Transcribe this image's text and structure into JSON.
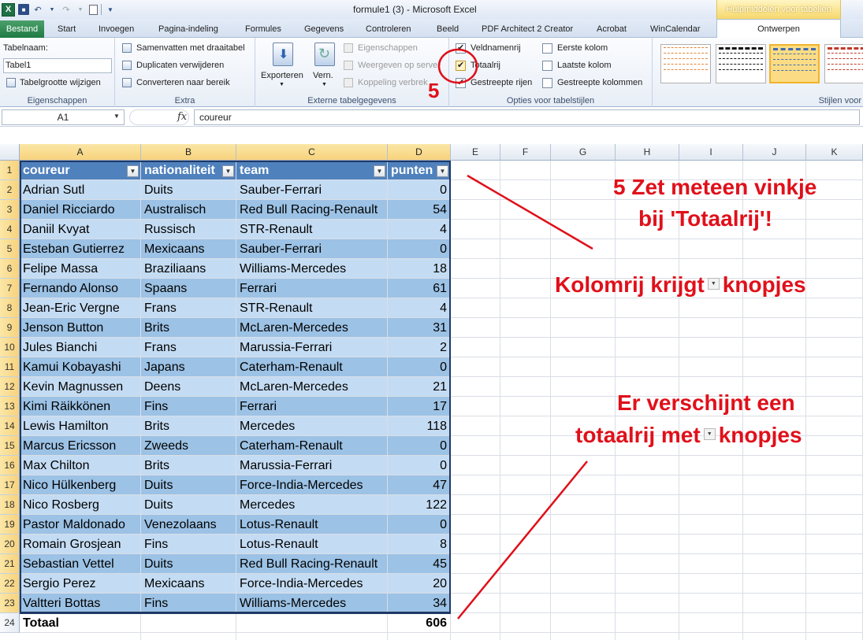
{
  "app": {
    "window_title": "formule1 (3)  -  Microsoft Excel",
    "context_tab_title": "Hulpmiddelen voor tabellen"
  },
  "tabs": [
    {
      "label": "Bestand"
    },
    {
      "label": "Start"
    },
    {
      "label": "Invoegen"
    },
    {
      "label": "Pagina-indeling"
    },
    {
      "label": "Formules"
    },
    {
      "label": "Gegevens"
    },
    {
      "label": "Controleren"
    },
    {
      "label": "Beeld"
    },
    {
      "label": "PDF Architect 2 Creator"
    },
    {
      "label": "Acrobat"
    },
    {
      "label": "WinCalendar"
    },
    {
      "label": "Ontwerpen"
    }
  ],
  "ribbon": {
    "eigenschappen": {
      "table_name_label": "Tabelnaam:",
      "table_name_value": "Tabel1",
      "resize_label": "Tabelgrootte wijzigen",
      "group_label": "Eigenschappen"
    },
    "extra": {
      "pivot_label": "Samenvatten met draaitabel",
      "remove_dup_label": "Duplicaten verwijderen",
      "convert_label": "Converteren naar bereik",
      "group_label": "Extra"
    },
    "extern": {
      "export_label": "Exporteren",
      "refresh_label": "Vern.",
      "properties_label": "Eigenschappen",
      "browser_label": "Weergeven op serve",
      "unlink_label": "Koppeling verbrek",
      "group_label": "Externe tabelgegevens"
    },
    "options": {
      "header_row": {
        "label": "Veldnamenrij",
        "checked": true
      },
      "total_row": {
        "label": "Totaalrij",
        "checked": true
      },
      "banded_rows": {
        "label": "Gestreepte rijen",
        "checked": true
      },
      "first_column": {
        "label": "Eerste kolom",
        "checked": false
      },
      "last_column": {
        "label": "Laatste kolom",
        "checked": false
      },
      "banded_columns": {
        "label": "Gestreepte kolommen",
        "checked": false
      },
      "group_label": "Opties voor tabelstijlen"
    },
    "styles": {
      "group_label": "Stijlen voor"
    }
  },
  "formula_bar": {
    "name_box": "A1",
    "fx_label": "fx",
    "formula": "coureur"
  },
  "grid": {
    "columns": [
      "A",
      "B",
      "C",
      "D",
      "E",
      "F",
      "G",
      "H",
      "I",
      "J",
      "K"
    ],
    "rows": [
      "1",
      "2",
      "3",
      "4",
      "5",
      "6",
      "7",
      "8",
      "9",
      "10",
      "11",
      "12",
      "13",
      "14",
      "15",
      "16",
      "17",
      "18",
      "19",
      "20",
      "21",
      "22",
      "23",
      "24"
    ],
    "table_headers": [
      "coureur",
      "nationaliteit",
      "team",
      "punten"
    ],
    "table_rows": [
      [
        "Adrian Sutl",
        "Duits",
        "Sauber-Ferrari",
        "0"
      ],
      [
        "Daniel Ricciardo",
        "Australisch",
        "Red Bull Racing-Renault",
        "54"
      ],
      [
        "Daniil Kvyat",
        "Russisch",
        "STR-Renault",
        "4"
      ],
      [
        "Esteban Gutierrez",
        "Mexicaans",
        "Sauber-Ferrari",
        "0"
      ],
      [
        "Felipe Massa",
        "Braziliaans",
        "Williams-Mercedes",
        "18"
      ],
      [
        "Fernando Alonso",
        "Spaans",
        "Ferrari",
        "61"
      ],
      [
        "Jean-Eric Vergne",
        "Frans",
        "STR-Renault",
        "4"
      ],
      [
        "Jenson Button",
        "Brits",
        "McLaren-Mercedes",
        "31"
      ],
      [
        "Jules Bianchi",
        "Frans",
        "Marussia-Ferrari",
        "2"
      ],
      [
        "Kamui Kobayashi",
        "Japans",
        "Caterham-Renault",
        "0"
      ],
      [
        "Kevin Magnussen",
        "Deens",
        "McLaren-Mercedes",
        "21"
      ],
      [
        "Kimi Räikkönen",
        "Fins",
        "Ferrari",
        "17"
      ],
      [
        "Lewis Hamilton",
        "Brits",
        "Mercedes",
        "118"
      ],
      [
        "Marcus Ericsson",
        "Zweeds",
        "Caterham-Renault",
        "0"
      ],
      [
        "Max Chilton",
        "Brits",
        "Marussia-Ferrari",
        "0"
      ],
      [
        "Nico Hülkenberg",
        "Duits",
        "Force-India-Mercedes",
        "47"
      ],
      [
        "Nico Rosberg",
        "Duits",
        "Mercedes",
        "122"
      ],
      [
        "Pastor Maldonado",
        "Venezolaans",
        "Lotus-Renault",
        "0"
      ],
      [
        "Romain Grosjean",
        "Fins",
        "Lotus-Renault",
        "8"
      ],
      [
        "Sebastian Vettel",
        "Duits",
        "Red Bull Racing-Renault",
        "45"
      ],
      [
        "Sergio Perez",
        "Mexicaans",
        "Force-India-Mercedes",
        "20"
      ],
      [
        "Valtteri Bottas",
        "Fins",
        "Williams-Mercedes",
        "34"
      ]
    ],
    "total_row": {
      "label": "Totaal",
      "value": "606"
    }
  },
  "annotations": {
    "step_number": "5",
    "line1": "5 Zet meteen vinkje",
    "line2": "bij 'Totaalrij'!",
    "line3a": "Kolomrij krijgt",
    "line3b": "knopjes",
    "line4": "Er verschijnt een",
    "line5a": "totaalrij met",
    "line5b": "knopjes",
    "color": "#e0101a"
  },
  "colors": {
    "table_header": "#4f81bd",
    "band_dark": "#9cc2e5",
    "band_light": "#c4dcf3",
    "excel_green": "#1f7a43"
  }
}
